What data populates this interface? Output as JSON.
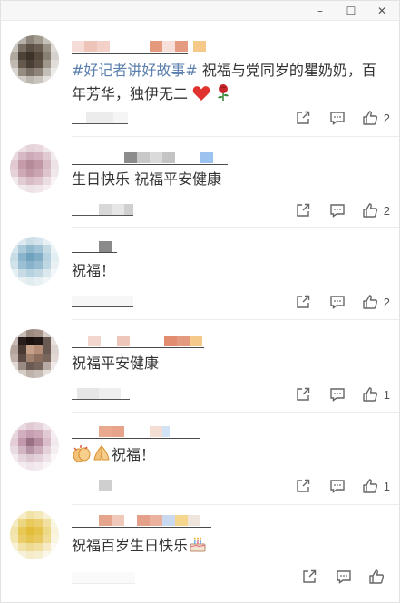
{
  "window": {
    "controls": {
      "minimize": "–",
      "maximize": "☐",
      "close": "✕"
    }
  },
  "comments": [
    {
      "hashtag": "#好记者讲好故事#",
      "text": " 祝福与党同岁的瞿奶奶，百年芳华，独伊无二",
      "emojis": [
        "red-heart",
        "rose"
      ],
      "likes": "2"
    },
    {
      "text": "生日快乐 祝福平安健康",
      "likes": "2"
    },
    {
      "text": "祝福！",
      "likes": "2"
    },
    {
      "text": "祝福平安健康",
      "likes": "1"
    },
    {
      "text": "祝福！",
      "emojis": [
        "clap",
        "pray"
      ],
      "likes": "1"
    },
    {
      "text": "祝福百岁生日快乐",
      "emojis": [
        "cake"
      ],
      "likes": ""
    }
  ],
  "colors": {
    "hashtag": "#5b7fae",
    "text": "#333333",
    "heart": "#e0332f"
  }
}
